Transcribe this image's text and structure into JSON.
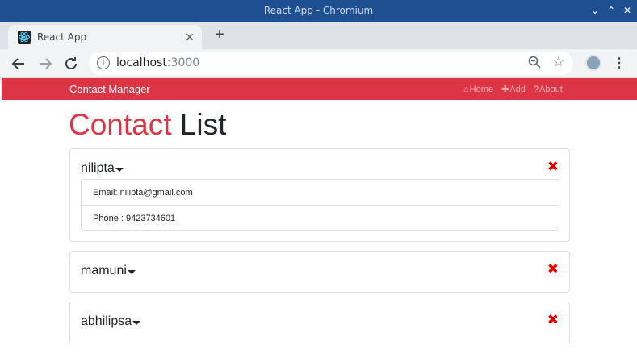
{
  "window": {
    "title": "React App - Chromium"
  },
  "tab": {
    "title": "React App",
    "favicon": "react-logo-icon",
    "close_glyph": "✕"
  },
  "toolbar": {
    "url_host": "localhost",
    "url_port": ":3000",
    "icons": [
      "back-arrow-icon",
      "forward-arrow-icon",
      "reload-icon",
      "info-icon",
      "zoom-icon",
      "star-icon",
      "profile-avatar",
      "menu-icon"
    ]
  },
  "navbar": {
    "brand": "Contact Manager",
    "links": [
      {
        "label": "Home",
        "icon": "home-icon"
      },
      {
        "label": "Add",
        "icon": "plus-icon"
      },
      {
        "label": "About",
        "icon": "question-icon"
      }
    ],
    "color": "#dc3545"
  },
  "heading": {
    "accent": "Contact",
    "rest": " List"
  },
  "contacts": [
    {
      "name": "nilipta",
      "expanded": true,
      "email_label": "Email: nilipta@gmail.com",
      "phone_label": "Phone : 9423734601"
    },
    {
      "name": "mamuni",
      "expanded": false
    },
    {
      "name": "abhilipsa",
      "expanded": false
    }
  ],
  "delete_glyph": "✖",
  "delete_color": "#e00000"
}
